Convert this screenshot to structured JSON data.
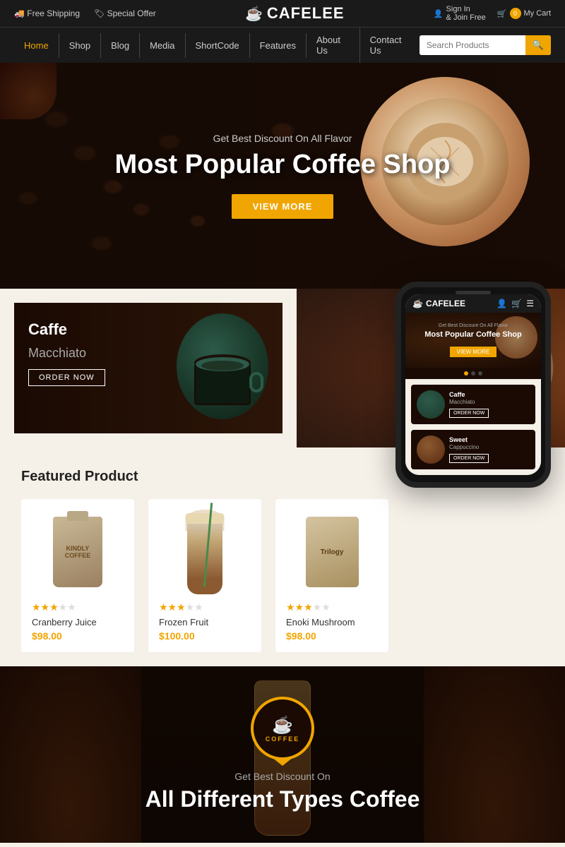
{
  "topbar": {
    "free_shipping": "Free Shipping",
    "special_offer": "Special Offer",
    "logo_text": "CAFELEE",
    "sign_in": "Sign In",
    "join_free": "& Join Free",
    "cart_label": "My Cart",
    "cart_count": "0"
  },
  "nav": {
    "links": [
      "Home",
      "Shop",
      "Blog",
      "Media",
      "ShortCode",
      "Features",
      "About Us",
      "Contact Us"
    ],
    "search_placeholder": "Search Products"
  },
  "hero": {
    "subtitle": "Get Best Discount On All Flavor",
    "title": "Most Popular Coffee Shop",
    "btn_label": "VIEW MORE"
  },
  "promo": {
    "card1_title": "Caffe",
    "card1_subtitle": "Macchiato",
    "card1_btn": "ORDER NOW",
    "card2_title": "Sweet",
    "card2_subtitle": "Cappuccino",
    "card2_btn": "ORDER NOW"
  },
  "featured": {
    "section_title": "Featured Product",
    "products": [
      {
        "name": "Cranberry Juice",
        "price": "$98.00",
        "rating": 3,
        "max_rating": 5,
        "bag_text": "KINDLY\nCOFFEE"
      },
      {
        "name": "Frozen Fruit",
        "price": "$100.00",
        "rating": 3,
        "max_rating": 5
      },
      {
        "name": "Enoki Mushroom",
        "price": "$98.00",
        "rating": 3,
        "max_rating": 5,
        "pouch_text": "Trilogy"
      }
    ]
  },
  "phone": {
    "logo": "CAFELEE",
    "hero_subtitle": "Get Best Discount On All Flavor",
    "hero_title": "Most Popular Coffee Shop",
    "hero_btn": "VIEW MORE",
    "card1_title": "Caffe",
    "card1_subtitle": "Macchiato",
    "card1_order": "ORDER NOW",
    "card2_title": "Sweet",
    "card2_subtitle": "Cappuccino",
    "card2_order": "ORDER NOW"
  },
  "bottom": {
    "badge_text": "COFFEE",
    "subtitle": "Get Best Discount On",
    "title": "All Different Types Coffee"
  }
}
